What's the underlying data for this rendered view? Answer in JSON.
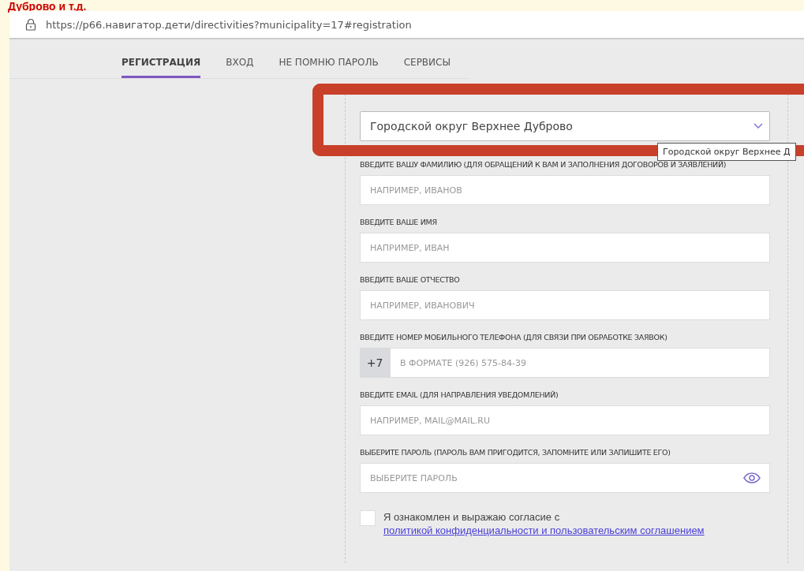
{
  "annotation": {
    "caption": "Дуброво и т.д."
  },
  "browser": {
    "url": "https://р66.навигатор.дети/directivities?municipality=17#registration"
  },
  "tabs": [
    {
      "label": "РЕГИСТРАЦИЯ",
      "selected": true
    },
    {
      "label": "ВХОД",
      "selected": false
    },
    {
      "label": "НЕ ПОМНЮ ПАРОЛЬ",
      "selected": false
    },
    {
      "label": "СЕРВИСЫ",
      "selected": false
    }
  ],
  "fields": [
    {
      "kind": "select",
      "value": "Городской округ Верхнее Дуброво",
      "tooltip": "Городской округ Верхнее Д"
    },
    {
      "kind": "text",
      "label": "ВВЕДИТЕ ВАШУ ФАМИЛИЮ (ДЛЯ ОБРАЩЕНИЙ К ВАМ И ЗАПОЛНЕНИЯ ДОГОВОРОВ И ЗАЯВЛЕНИЙ)",
      "placeholder": "НАПРИМЕР, ИВАНОВ"
    },
    {
      "kind": "text",
      "label": "ВВЕДИТЕ ВАШЕ ИМЯ",
      "placeholder": "НАПРИМЕР, ИВАН"
    },
    {
      "kind": "text",
      "label": "ВВЕДИТЕ ВАШЕ ОТЧЕСТВО",
      "placeholder": "НАПРИМЕР, ИВАНОВИЧ"
    },
    {
      "kind": "phone",
      "label": "ВВЕДИТЕ НОМЕР МОБИЛЬНОГО ТЕЛЕФОНА (ДЛЯ СВЯЗИ ПРИ ОБРАБОТКЕ ЗАЯВОК)",
      "prefix": "+7",
      "placeholder": "В ФОРМАТЕ (926) 575-84-39"
    },
    {
      "kind": "text",
      "label": "ВВЕДИТЕ EMAIL (ДЛЯ НАПРАВЛЕНИЯ УВЕДОМЛЕНИЙ)",
      "placeholder": "НАПРИМЕР, MAIL@MAIL.RU"
    },
    {
      "kind": "password",
      "label": "ВЫБЕРИТЕ ПАРОЛЬ (ПАРОЛЬ ВАМ ПРИГОДИТСЯ, ЗАПОМНИТЕ ИЛИ ЗАПИШИТЕ ЕГО)",
      "placeholder": "ВЫБЕРИТЕ ПАРОЛЬ"
    }
  ],
  "consent": {
    "checked": false,
    "text": "Я ознакомлен и выражаю согласие с ",
    "link": "политикой конфиденциальности и пользовательским соглашением"
  }
}
